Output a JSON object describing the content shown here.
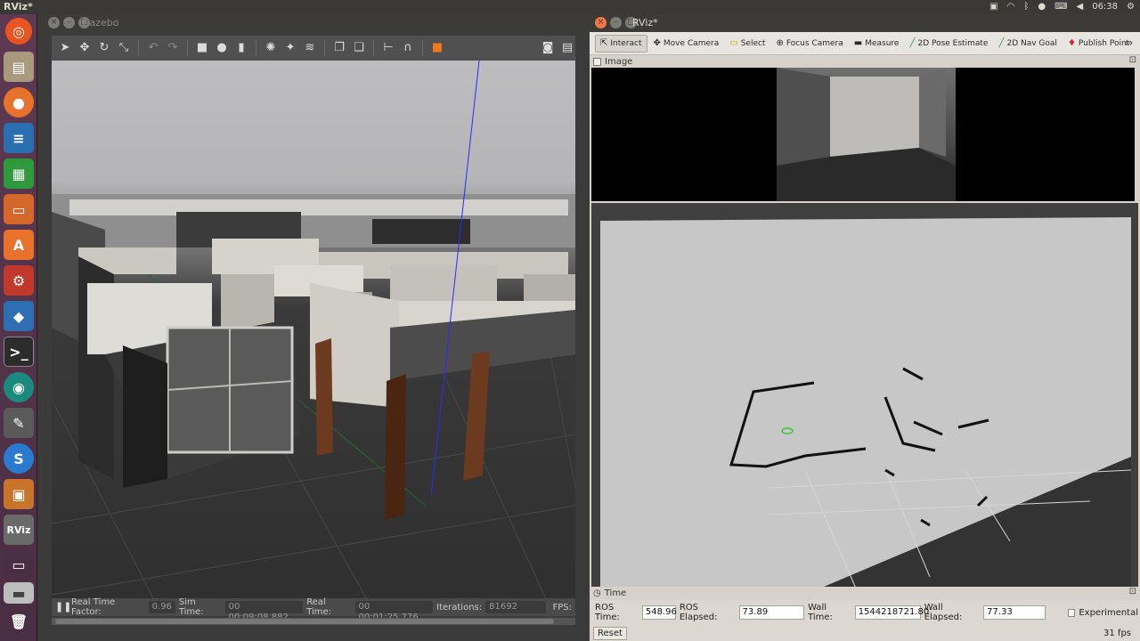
{
  "top_panel": {
    "active_app": "RViz*",
    "clock": "06:38"
  },
  "launcher": {
    "items": [
      "ubuntu-logo",
      "files",
      "firefox",
      "libreoffice-writer",
      "libreoffice-calc",
      "libreoffice-impress",
      "ubuntu-software",
      "system-settings",
      "vscode",
      "terminal",
      "gitkraken",
      "rqt",
      "shutter",
      "virtualbox",
      "rviz",
      "workspace-switcher",
      "usb-drive",
      "trash"
    ],
    "rviz_label": "RViz"
  },
  "gazebo": {
    "title": "Gazebo",
    "status": {
      "rtf_label": "Real Time Factor:",
      "rtf_value": "0.96",
      "sim_time_label": "Sim Time:",
      "sim_time_value": "00 00:09:08.882",
      "real_time_label": "Real Time:",
      "real_time_value": "00 00:01:25.776",
      "iterations_label": "Iterations:",
      "iterations_value": "81692",
      "fps_label": "FPS:"
    }
  },
  "rviz": {
    "title": "RViz*",
    "tools": [
      "Interact",
      "Move Camera",
      "Select",
      "Focus Camera",
      "Measure",
      "2D Pose Estimate",
      "2D Nav Goal",
      "Publish Point"
    ],
    "image_panel_title": "Image",
    "time_panel_title": "Time",
    "time": {
      "ros_time_label": "ROS Time:",
      "ros_time_value": "548.96",
      "ros_elapsed_label": "ROS Elapsed:",
      "ros_elapsed_value": "73.89",
      "wall_time_label": "Wall Time:",
      "wall_time_value": "1544218721.80",
      "wall_elapsed_label": "Wall Elapsed:",
      "wall_elapsed_value": "77.33",
      "experimental_label": "Experimental"
    },
    "reset_label": "Reset",
    "fps": "31 fps"
  }
}
